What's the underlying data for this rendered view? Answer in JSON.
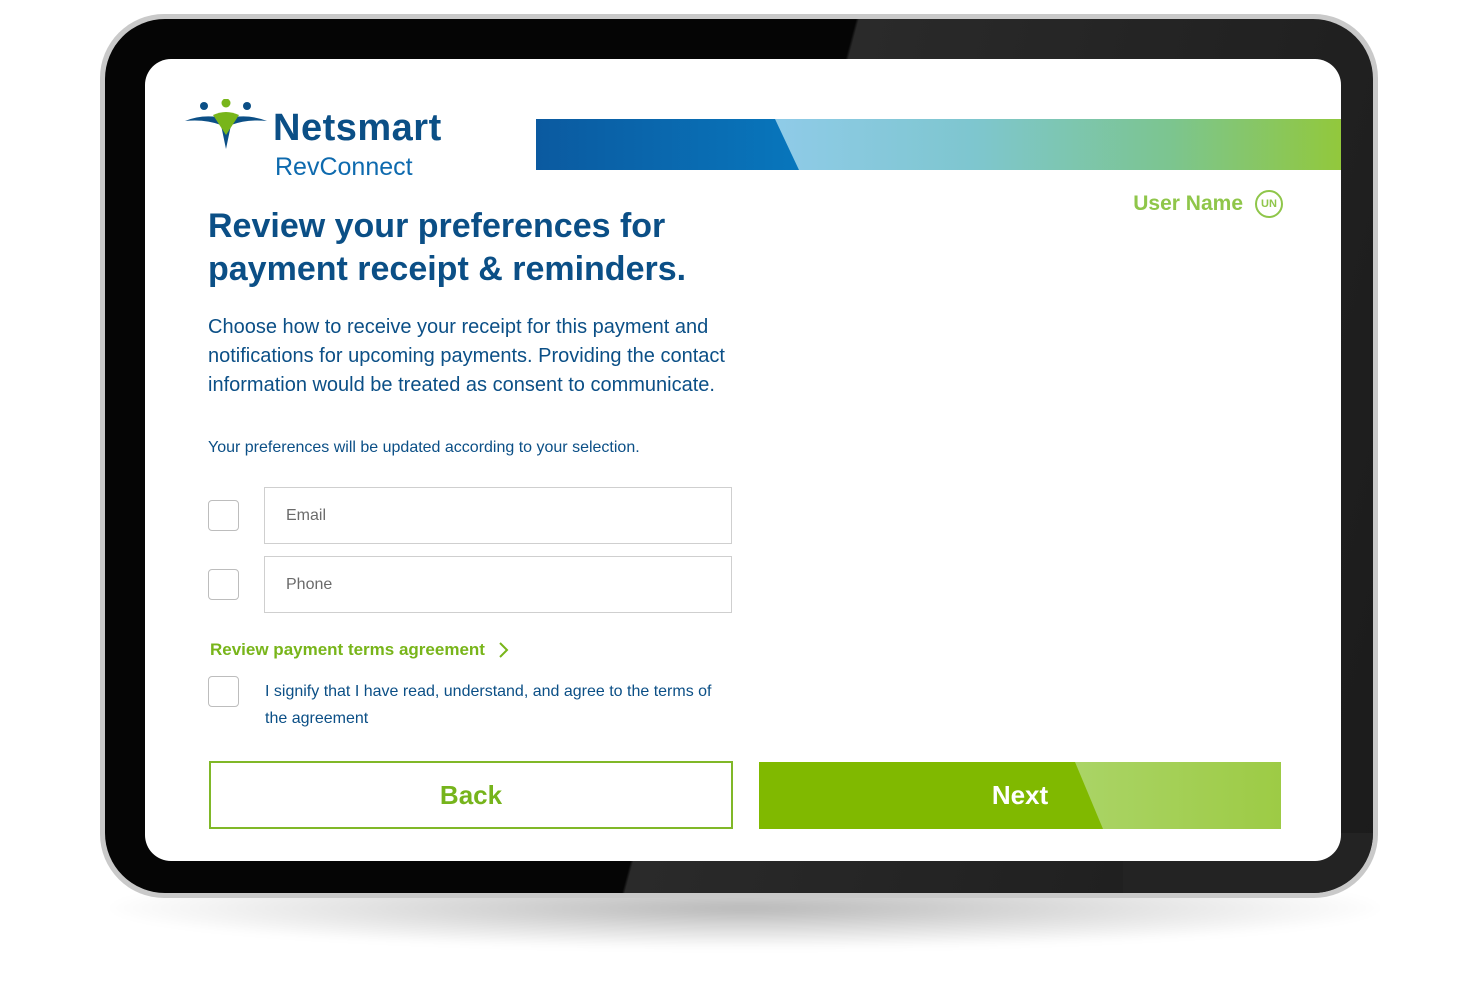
{
  "brand": {
    "name": "Netsmart",
    "product": "RevConnect",
    "colors": {
      "navy": "#0b4f86",
      "green": "#80b900",
      "light_green": "#8fc64a"
    }
  },
  "user": {
    "name": "User Name",
    "initials": "UN"
  },
  "page": {
    "title": "Review your preferences for payment receipt & reminders.",
    "description": "Choose how to receive your receipt for this payment and notifications for upcoming payments. Providing the contact information would be treated as consent to communicate.",
    "note": "Your preferences will be updated according to your selection."
  },
  "form": {
    "email_placeholder": "Email",
    "phone_placeholder": "Phone",
    "terms_link": "Review payment terms agreement",
    "agree_text": "I signify that I have read, understand, and agree to the terms of the agreement"
  },
  "actions": {
    "back": "Back",
    "next": "Next"
  }
}
